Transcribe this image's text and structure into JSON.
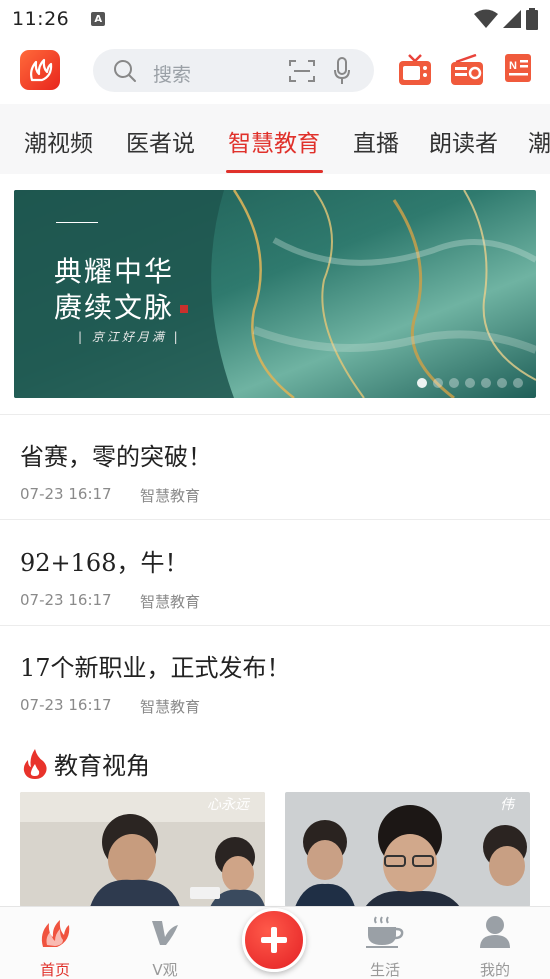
{
  "status_bar": {
    "time": "11:26",
    "indicator": "A"
  },
  "search": {
    "placeholder": "搜索"
  },
  "tabs": [
    {
      "label": "潮视频"
    },
    {
      "label": "医者说"
    },
    {
      "label": "智慧教育"
    },
    {
      "label": "直播"
    },
    {
      "label": "朗读者"
    },
    {
      "label": "潮"
    }
  ],
  "active_tab_index": 2,
  "banner": {
    "line1": "典耀中华",
    "line2": "赓续文脉",
    "subtitle": "| 京江好月满 |",
    "slide_count": 7,
    "active_slide": 0
  },
  "articles": [
    {
      "title": "省赛，零的突破！",
      "time": "07-23 16:17",
      "category": "智慧教育"
    },
    {
      "title": "92+168，牛！",
      "time": "07-23 16:17",
      "category": "智慧教育"
    },
    {
      "title": "17个新职业，正式发布！",
      "time": "07-23 16:17",
      "category": "智慧教育"
    }
  ],
  "section": {
    "title": "教育视角"
  },
  "cards": [
    {
      "tag": "心永远"
    },
    {
      "tag": "伟"
    }
  ],
  "bottom_nav": [
    {
      "label": "首页",
      "icon": "home-logo-icon",
      "active": true
    },
    {
      "label": "V观",
      "icon": "v-icon",
      "active": false
    },
    {
      "label": "",
      "icon": "plus-icon",
      "active": false
    },
    {
      "label": "生活",
      "icon": "coffee-cup-icon",
      "active": false
    },
    {
      "label": "我的",
      "icon": "person-icon",
      "active": false
    }
  ],
  "colors": {
    "accent": "#e0312b",
    "tab_bg": "#f7f7f8",
    "search_bg": "#eef0f3"
  }
}
